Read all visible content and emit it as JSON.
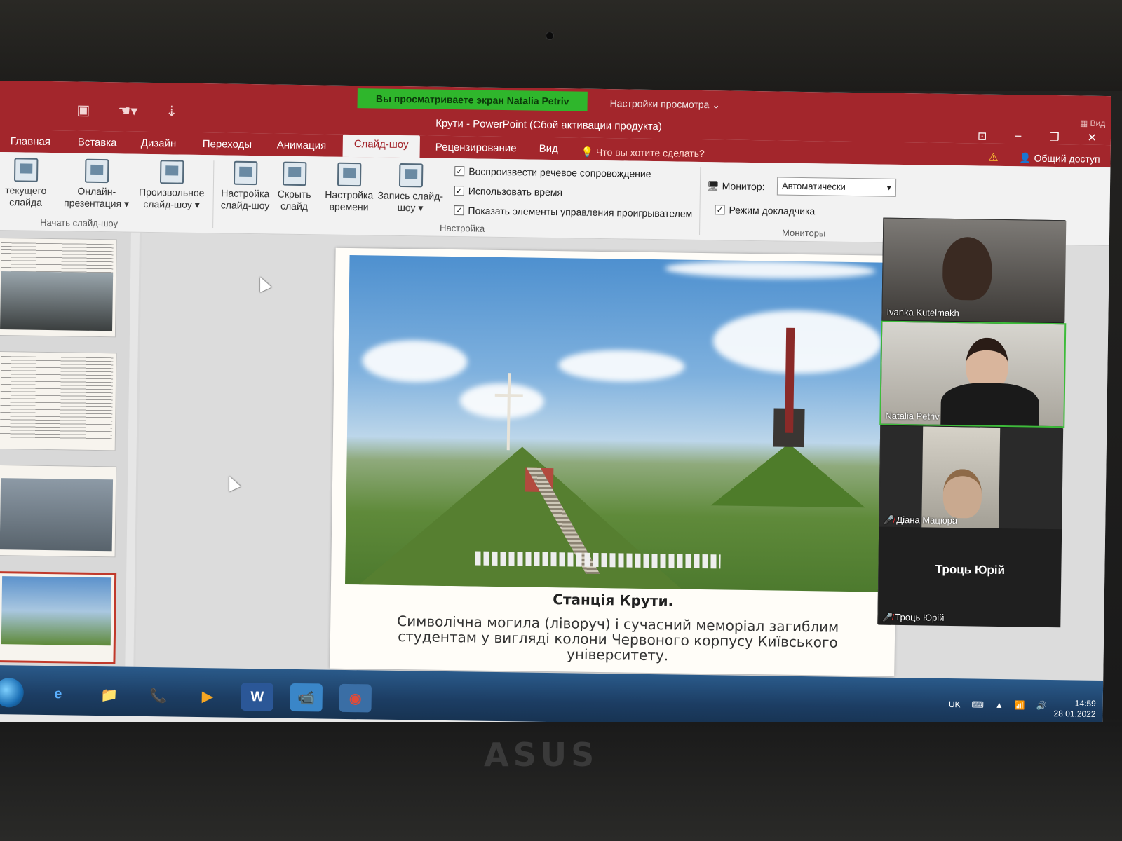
{
  "zoom": {
    "banner": "Вы просматриваете экран Natalia Petriv",
    "view_options": "Настройки просмотра ⌄",
    "participants": [
      {
        "name": "Ivanka Kutelmakh",
        "muted": false
      },
      {
        "name": "Natalia Petriv",
        "muted": false,
        "active": true
      },
      {
        "name": "Діана Мацюра",
        "muted": true
      },
      {
        "name": "Троць Юрій",
        "muted": true,
        "video": false
      }
    ],
    "view_button": "Вид"
  },
  "window": {
    "title": "Крути - PowerPoint (Сбой активации продукта)",
    "controls": [
      "⊡",
      "–",
      "❐",
      "✕"
    ]
  },
  "ribbon": {
    "tabs": [
      "Главная",
      "Вставка",
      "Дизайн",
      "Переходы",
      "Анимация",
      "Слайд-шоу",
      "Рецензирование",
      "Вид"
    ],
    "active_tab": "Слайд-шоу",
    "tell_me": "Что вы хотите сделать?",
    "share": "Общий доступ",
    "group_start": {
      "label": "Начать слайд-шоу",
      "buttons": [
        "текущего слайда",
        "Онлайн-презентация ▾",
        "Произвольное слайд-шоу ▾"
      ]
    },
    "group_setup": {
      "label": "Настройка",
      "buttons": [
        "Настройка слайд-шоу",
        "Скрыть слайд",
        "Настройка времени",
        "Запись слайд-шоу ▾"
      ],
      "checks": [
        {
          "label": "Воспроизвести речевое сопровождение",
          "checked": true
        },
        {
          "label": "Использовать время",
          "checked": true
        },
        {
          "label": "Показать элементы управления проигрывателем",
          "checked": true
        }
      ]
    },
    "group_monitors": {
      "label": "Мониторы",
      "monitor_label": "Монитор:",
      "monitor_value": "Автоматически",
      "presenter_view": {
        "label": "Режим докладчика",
        "checked": true
      }
    }
  },
  "slide": {
    "title": "Станція Крути.",
    "body": "Символічна могила (ліворуч) і сучасний меморіал загиблим студентам у вигляді колони Червоного корпусу Київського університету."
  },
  "taskbar": {
    "apps": [
      "e",
      "📁",
      "📞",
      "▶",
      "W",
      "📹",
      "◉"
    ],
    "language": "UK",
    "time": "14:59",
    "date": "28.01.2022"
  },
  "laptop_brand": "ASUS"
}
